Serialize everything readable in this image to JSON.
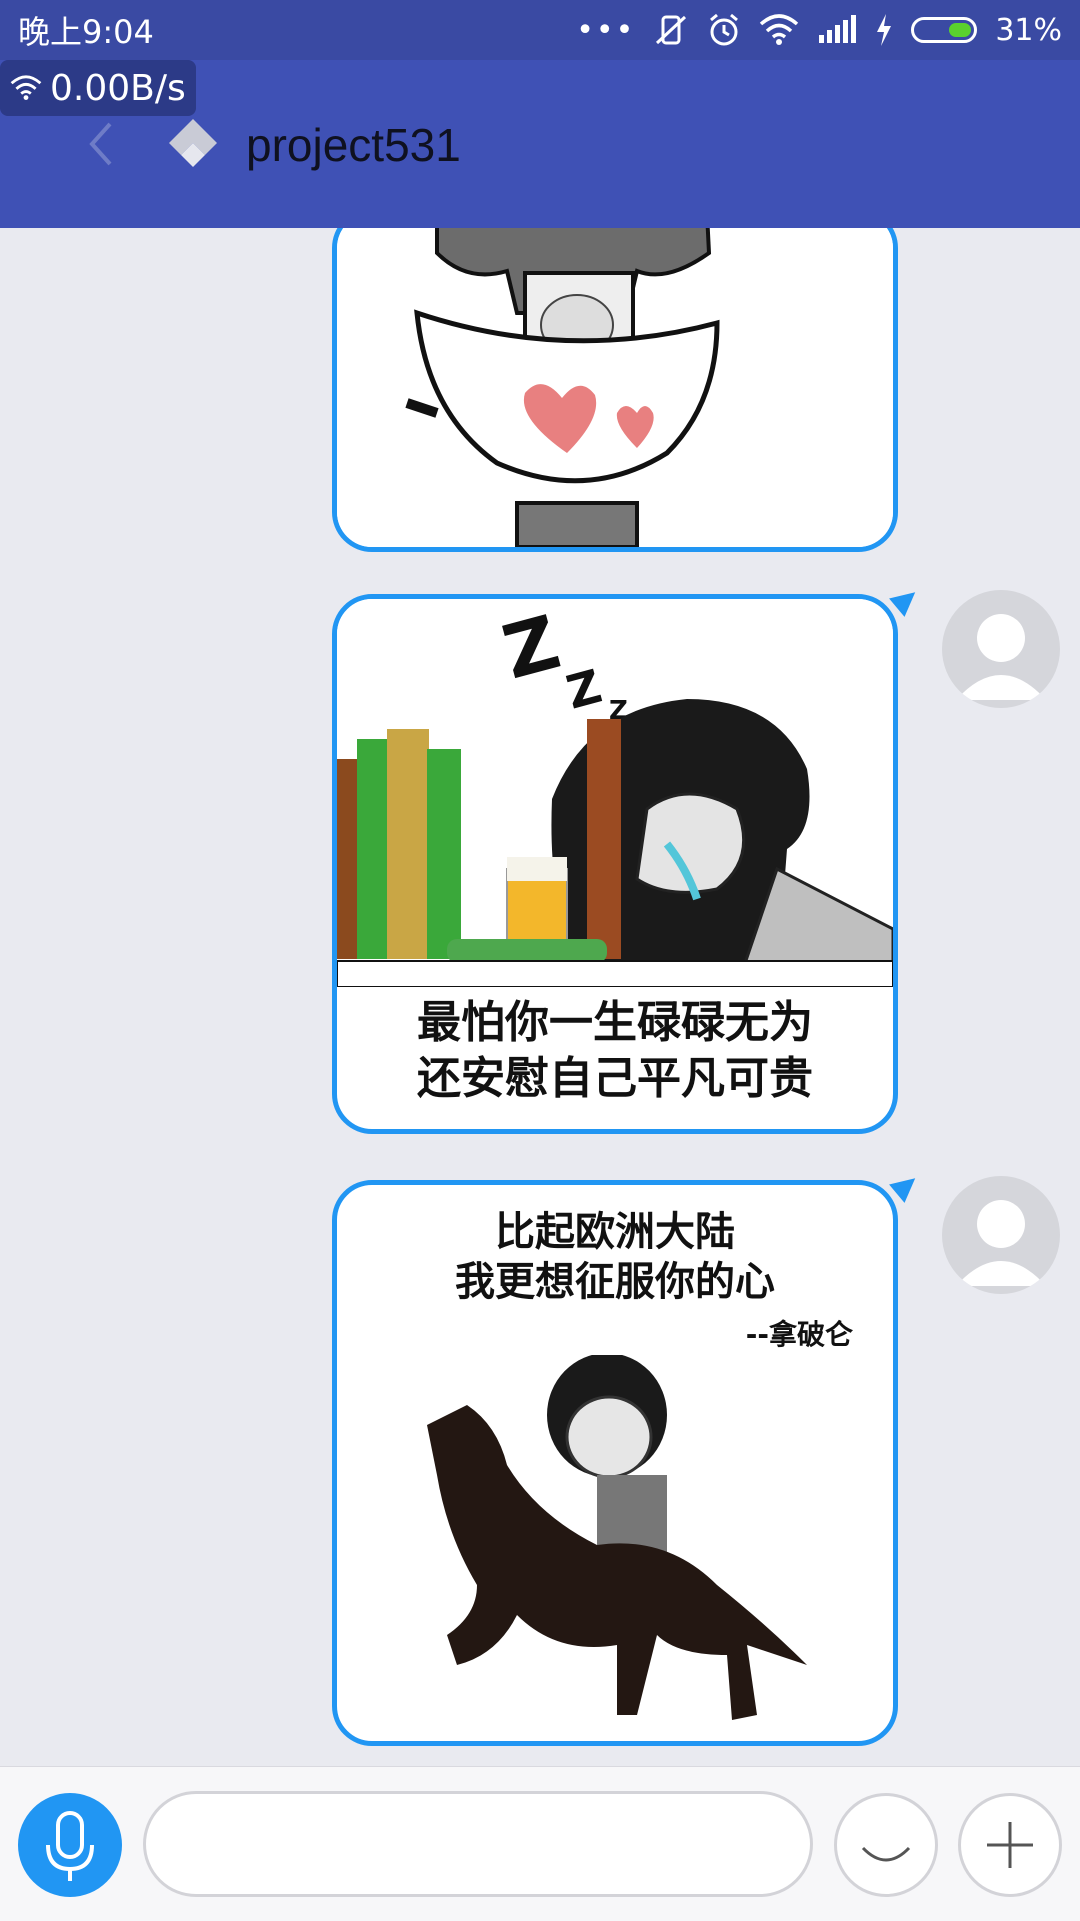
{
  "status_bar": {
    "time": "晚上9:04",
    "dots": "•••",
    "battery": "31%"
  },
  "network_speed": "0.00B/s",
  "header": {
    "title": "project531"
  },
  "messages": [
    {
      "type": "image",
      "meme": "chef-mask-hearts",
      "caption_lines": []
    },
    {
      "type": "image",
      "meme": "sleeping-with-beer",
      "caption_lines": [
        "最怕你一生碌碌无为",
        "还安慰自己平凡可贵"
      ]
    },
    {
      "type": "image",
      "meme": "napoleon-horse",
      "caption_lines": [
        "比起欧洲大陆",
        "我更想征服你的心"
      ],
      "signature": "--拿破仑"
    }
  ],
  "input": {
    "value": "",
    "placeholder": ""
  },
  "icons": {
    "back": "chevron-left-icon",
    "logo": "app-logo-icon",
    "mic": "microphone-icon",
    "emoji": "smiley-icon",
    "plus": "plus-icon",
    "avatar": "default-avatar-icon"
  },
  "colors": {
    "status_bar": "#3a4aa3",
    "app_bar": "#3f51b5",
    "bubble_border": "#2196f3",
    "chat_bg": "#e9eaf0"
  }
}
